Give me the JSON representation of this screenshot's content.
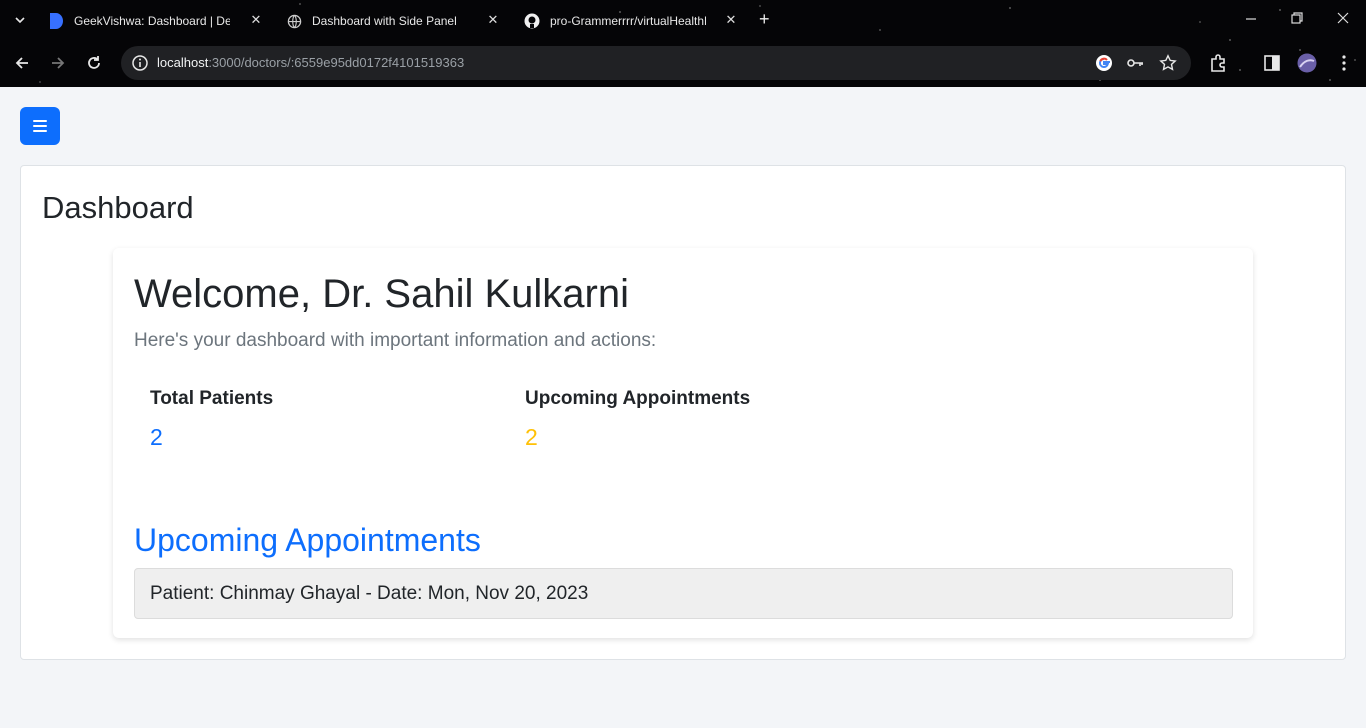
{
  "browser": {
    "tabs": [
      {
        "title": "GeekVishwa: Dashboard | Devfo",
        "icon": "devfolio-icon",
        "active": false
      },
      {
        "title": "Dashboard with Side Panel",
        "icon": "globe-icon",
        "active": true
      },
      {
        "title": "pro-Grammerrrr/virtualHealthR",
        "icon": "github-icon",
        "active": false
      }
    ],
    "url_host": "localhost",
    "url_rest": ":3000/doctors/:6559e95dd0172f4101519363"
  },
  "page": {
    "menu_icon": "hamburger-icon",
    "dashboard_title": "Dashboard",
    "welcome": "Welcome, Dr. Sahil Kulkarni",
    "lead": "Here's your dashboard with important information and actions:",
    "stats": [
      {
        "label": "Total Patients",
        "value": "2",
        "color": "#0d6efd"
      },
      {
        "label": "Upcoming Appointments",
        "value": "2",
        "color": "#ffc107"
      }
    ],
    "appointments_heading": "Upcoming Appointments",
    "appointments": [
      {
        "text": "Patient: Chinmay Ghayal - Date: Mon, Nov 20, 2023"
      }
    ]
  },
  "colors": {
    "primary": "#0d6efd",
    "warning": "#ffc107",
    "page_bg": "#f3f5f8"
  }
}
